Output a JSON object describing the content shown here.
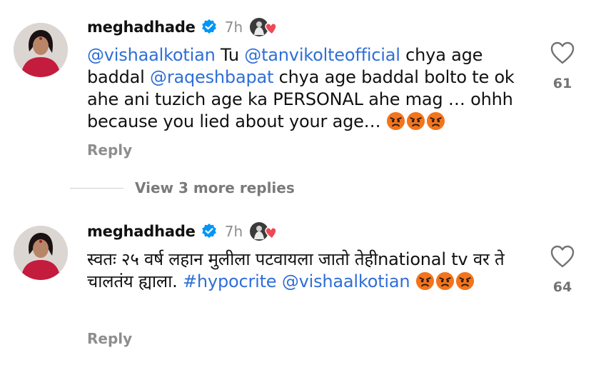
{
  "comments": [
    {
      "username": "meghadhade",
      "time": "7h",
      "segments": [
        {
          "type": "mention",
          "text": "@vishaalkotian"
        },
        {
          "type": "text",
          "text": " Tu "
        },
        {
          "type": "mention",
          "text": "@tanvikolteofficial"
        },
        {
          "type": "text",
          "text": " chya age baddal "
        },
        {
          "type": "mention",
          "text": "@raqeshbapat"
        },
        {
          "type": "text",
          "text": " chya age baddal bolto te ok ahe ani tuzich age ka PERSONAL ahe mag … ohhh because you lied about your age… "
        },
        {
          "type": "emoji",
          "name": "angry-face-icon"
        },
        {
          "type": "emoji",
          "name": "angry-face-icon"
        },
        {
          "type": "emoji",
          "name": "angry-face-icon"
        }
      ],
      "reply_label": "Reply",
      "like_count": "61"
    },
    {
      "username": "meghadhade",
      "time": "7h",
      "segments": [
        {
          "type": "text",
          "text": "स्वतः २५ वर्ष लहान मुलीला पटवायला जातो तेहीnational tv वर ते चालतंय ह्याला. "
        },
        {
          "type": "hashtag",
          "text": "#hypocrite"
        },
        {
          "type": "text",
          "text": " "
        },
        {
          "type": "mention",
          "text": "@vishaalkotian"
        },
        {
          "type": "text",
          "text": " "
        },
        {
          "type": "emoji",
          "name": "angry-face-icon"
        },
        {
          "type": "emoji",
          "name": "angry-face-icon"
        },
        {
          "type": "emoji",
          "name": "angry-face-icon"
        }
      ],
      "reply_label": "Reply",
      "like_count": "64"
    }
  ],
  "view_replies": {
    "label": "View 3 more replies"
  },
  "colors": {
    "mention": "#2f6fd6",
    "verified": "#0095f6",
    "muted": "#8e8e8e",
    "heart": "#ed4956"
  },
  "icons": [
    "verified-badge-icon",
    "creator-liked-heart-icon",
    "heart-outline-icon",
    "angry-face-icon"
  ]
}
